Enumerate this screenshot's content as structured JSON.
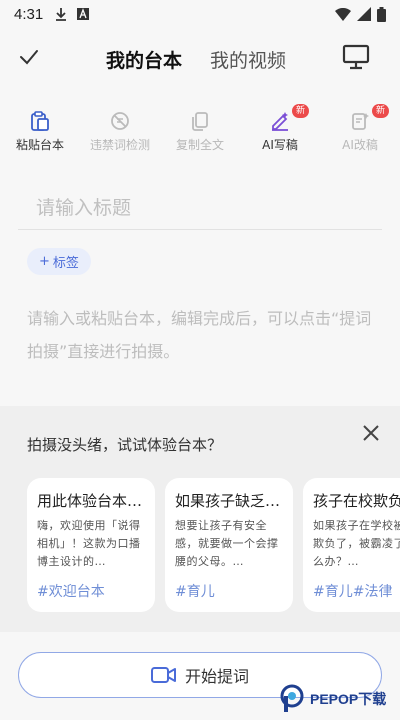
{
  "status_bar": {
    "time": "4:31",
    "icons": [
      "download-icon",
      "app-a-icon",
      "wifi-icon",
      "signal-icon",
      "battery-icon"
    ]
  },
  "header": {
    "tabs": [
      {
        "label": "我的台本",
        "active": true
      },
      {
        "label": "我的视频",
        "active": false
      }
    ]
  },
  "toolbar": {
    "items": [
      {
        "label": "粘贴台本",
        "icon": "clipboard-paste-icon",
        "enabled": true,
        "badge": ""
      },
      {
        "label": "违禁词检测",
        "icon": "forbidden-word-icon",
        "enabled": false,
        "badge": ""
      },
      {
        "label": "复制全文",
        "icon": "copy-icon",
        "enabled": false,
        "badge": ""
      },
      {
        "label": "AI写稿",
        "icon": "ai-write-icon",
        "enabled": true,
        "badge": "新"
      },
      {
        "label": "AI改稿",
        "icon": "ai-rewrite-icon",
        "enabled": false,
        "badge": "新"
      }
    ]
  },
  "editor": {
    "title_placeholder": "请输入标题",
    "tag_label": "标签",
    "content_placeholder": "请输入或粘贴台本，编辑完成后，可以点击“提词拍摄”直接进行拍摄。"
  },
  "suggestions": {
    "heading": "拍摄没头绪，试试体验台本？",
    "cards": [
      {
        "title": "用此体验台本…",
        "desc": "嗨，欢迎使用「说得相机」！这款为口播博主设计的…",
        "tag": "#欢迎台本"
      },
      {
        "title": "如果孩子缺乏…",
        "desc": "想要让孩子有安全感，就要做一个会撑腰的父母。…",
        "tag": "#育儿"
      },
      {
        "title": "孩子在校欺负",
        "desc": "如果孩子在学校被人欺负了，被霸凌了怎么办？…",
        "tag": "#育儿#法律"
      }
    ]
  },
  "action": {
    "start_label": "开始提词"
  },
  "watermark": {
    "text": "PEPOP下载"
  },
  "colors": {
    "accent": "#4a6bd8",
    "badge": "#ec4a4a",
    "tag_text": "#6f8ed6"
  }
}
